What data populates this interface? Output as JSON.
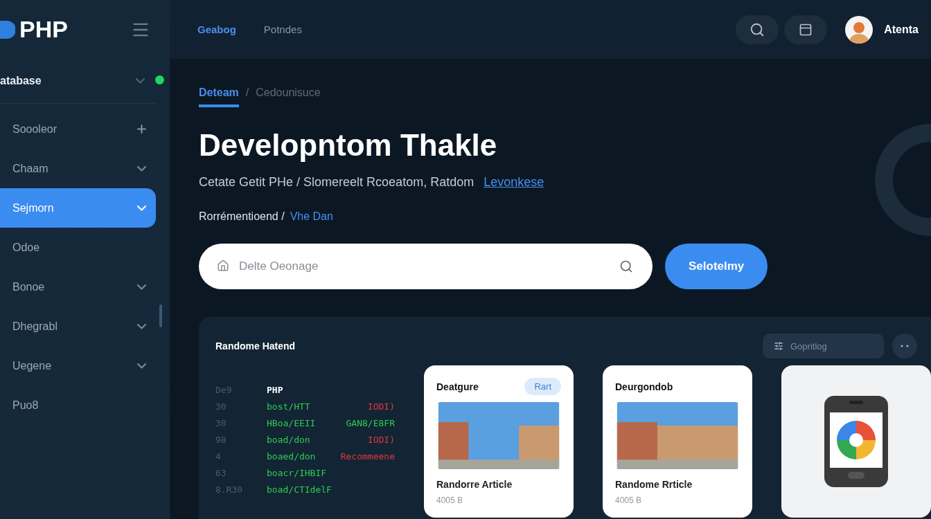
{
  "brand": {
    "name": "PHP"
  },
  "nav": [
    {
      "label": "Geabog",
      "selected": true
    },
    {
      "label": "Potndes",
      "selected": false
    }
  ],
  "user": {
    "name": "Atenta"
  },
  "sidebar": {
    "title": "atabase",
    "online": true,
    "items": [
      {
        "label": "Soooleor",
        "kind": "add",
        "selected": false
      },
      {
        "label": "Chaam",
        "kind": "expandable",
        "selected": false
      },
      {
        "label": "Sejmorn",
        "kind": "expandable",
        "selected": true
      },
      {
        "label": "Odoe",
        "kind": "plain",
        "selected": false
      },
      {
        "label": "Bonoe",
        "kind": "expandable",
        "selected": false
      },
      {
        "label": "Dhegrabl",
        "kind": "expandable",
        "selected": false
      },
      {
        "label": "Uegene",
        "kind": "expandable",
        "selected": false
      },
      {
        "label": "Puo8",
        "kind": "plain",
        "selected": false
      }
    ]
  },
  "breadcrumb": {
    "separator": "/",
    "items": [
      {
        "label": "Deteam",
        "selected": true
      },
      {
        "label": "Cedounisuce",
        "selected": false
      }
    ]
  },
  "title": "Developntom Thakle",
  "subtitle": {
    "text": "Cetate Getit PHe / Slomereelt Rcoeatom, Ratdom",
    "link": "Levonkese"
  },
  "tagline": {
    "text": "Rorrémentioend /",
    "link": "Vhe Dan"
  },
  "search": {
    "placeholder": "Delte Oeonage",
    "button": "Selotelmy"
  },
  "panel": {
    "title": "Randome Hatend",
    "filter": "Gopritlog",
    "code": [
      {
        "kind": "header",
        "line": "De9",
        "text": "PHP"
      },
      {
        "kind": "code",
        "line": "30",
        "text": "bost/HTT",
        "note": "IODI)",
        "color": "#e0393e"
      },
      {
        "kind": "code",
        "line": "30",
        "text": "HBoa/EEII",
        "note": "GAN8/E8FR",
        "color": "#2ecc55"
      },
      {
        "kind": "code",
        "line": "98",
        "text": "boad/don",
        "note": "IODI)",
        "color": "#e0393e"
      },
      {
        "kind": "code",
        "line": "4",
        "text": "boaed/don",
        "note": "Recommeene",
        "color": "#e0393e"
      },
      {
        "kind": "code",
        "line": "63",
        "text": "boacr/IHBIF"
      },
      {
        "kind": "code",
        "line": "8.R30",
        "text": "boad/CTIdelF"
      }
    ],
    "cards": [
      {
        "kind": "article",
        "heading": "Deatgure",
        "badge": "Rart",
        "caption": "Randorre Article",
        "meta": "4005 B"
      },
      {
        "kind": "article",
        "heading": "Deurgondob",
        "caption": "Randome Rrticle",
        "meta": "4005 B"
      },
      {
        "kind": "app"
      }
    ]
  }
}
